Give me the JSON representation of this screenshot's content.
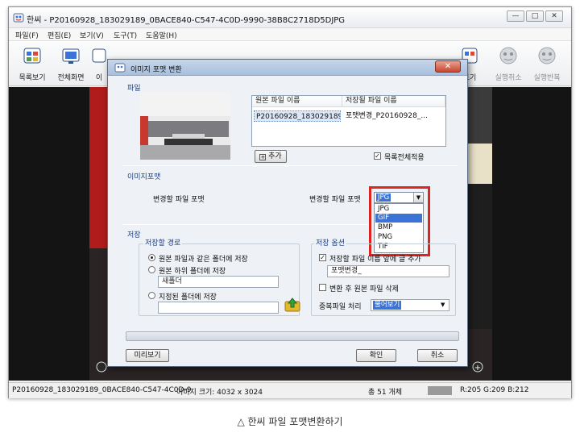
{
  "window": {
    "title": "한씨 - P20160928_183029189_0BACE840-C547-4C0D-9990-38B8C2718D5DJPG",
    "controls": {
      "minimize": "—",
      "maximize": "□",
      "close": "✕"
    }
  },
  "menu": [
    "파일(F)",
    "편집(E)",
    "보기(V)",
    "도구(T)",
    "도움말(H)"
  ],
  "toolbar": {
    "left": [
      {
        "label": "목록보기",
        "icon": "list-view-icon"
      },
      {
        "label": "전체화면",
        "icon": "fullscreen-icon"
      },
      {
        "label": "이",
        "icon": "image-icon"
      }
    ],
    "right": [
      {
        "label": "드기",
        "icon": "tool-icon"
      },
      {
        "label": "실행취소",
        "icon": "undo-icon"
      },
      {
        "label": "실행반복",
        "icon": "redo-icon"
      }
    ]
  },
  "dialog": {
    "title": "이미지 포맷 변환",
    "close": "✕",
    "file_section": {
      "label": "파일",
      "columns": [
        "원본 파일 이름",
        "저장될 파일 이름"
      ],
      "rows": [
        {
          "original": "P20160928_183029189...",
          "saved": "포맷변경_P20160928_..."
        }
      ],
      "add_button": "추가",
      "apply_all": {
        "label": "목록전체적용",
        "checked": true
      }
    },
    "format_section": {
      "label": "이미지포맷",
      "left_label": "변경할 파일 포맷",
      "right_label": "변경할 파일 포맷",
      "selected": "JPG",
      "options": [
        "JPG",
        "GIF",
        "BMP",
        "PNG",
        "TIF"
      ],
      "highlighted": "GIF"
    },
    "save_section": {
      "label": "저장",
      "path_group": {
        "label": "저장할 경로",
        "radio_same": "원본 파일과 같은 폴더에 저장",
        "radio_sub": "원본 하위 폴더에 저장",
        "subfolder_value": "새폴더",
        "radio_custom": "지정된 폴더에 저장",
        "custom_value": ""
      },
      "options_group": {
        "label": "저장 옵션",
        "prefix_check": {
          "label": "저장할 파일 이름 앞에 글 추가",
          "checked": true
        },
        "prefix_value": "포맷변경_",
        "delete_check": {
          "label": "변환 후 원본 파일 삭제",
          "checked": false
        },
        "duplicate_label": "중복파일 처리",
        "duplicate_value": "물어보기"
      }
    },
    "buttons": {
      "preview": "미리보기",
      "ok": "확인",
      "cancel": "취소"
    }
  },
  "statusbar": {
    "filename": "P20160928_183029189_0BACE840-C547-4C0D-9",
    "size": "이미지 크기: 4032 x 3024",
    "count": "총 51 개체",
    "color": "R:205 G:209 B:212"
  },
  "caption": "△ 한씨 파일 포맷변환하기",
  "colors": {
    "accent": "#3b74d6",
    "highlight": "#e0241f",
    "section": "#1d3f82"
  }
}
